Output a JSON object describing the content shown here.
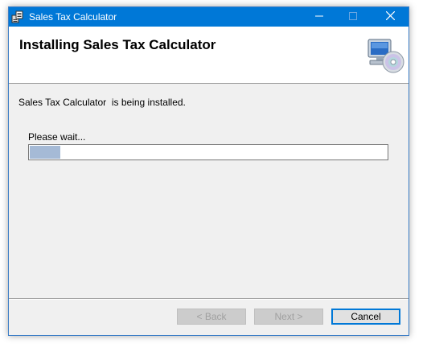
{
  "window": {
    "title": "Sales Tax Calculator",
    "app_icon": "installer-app-icon",
    "controls": {
      "minimize_icon": "minimize-icon",
      "maximize_icon": "maximize-icon",
      "close_icon": "close-icon"
    }
  },
  "banner": {
    "title": "Installing Sales Tax Calculator",
    "icon": "computer-cd-icon"
  },
  "body": {
    "status": "Sales Tax Calculator  is being installed.",
    "wait_label": "Please wait...",
    "progress_fraction": 0.085
  },
  "buttons": {
    "back": "< Back",
    "next": "Next >",
    "cancel": "Cancel"
  },
  "colors": {
    "titlebar": "#0078d7",
    "progress_fill": "#a5bad6",
    "dialog_bg": "#f0f0f0"
  }
}
